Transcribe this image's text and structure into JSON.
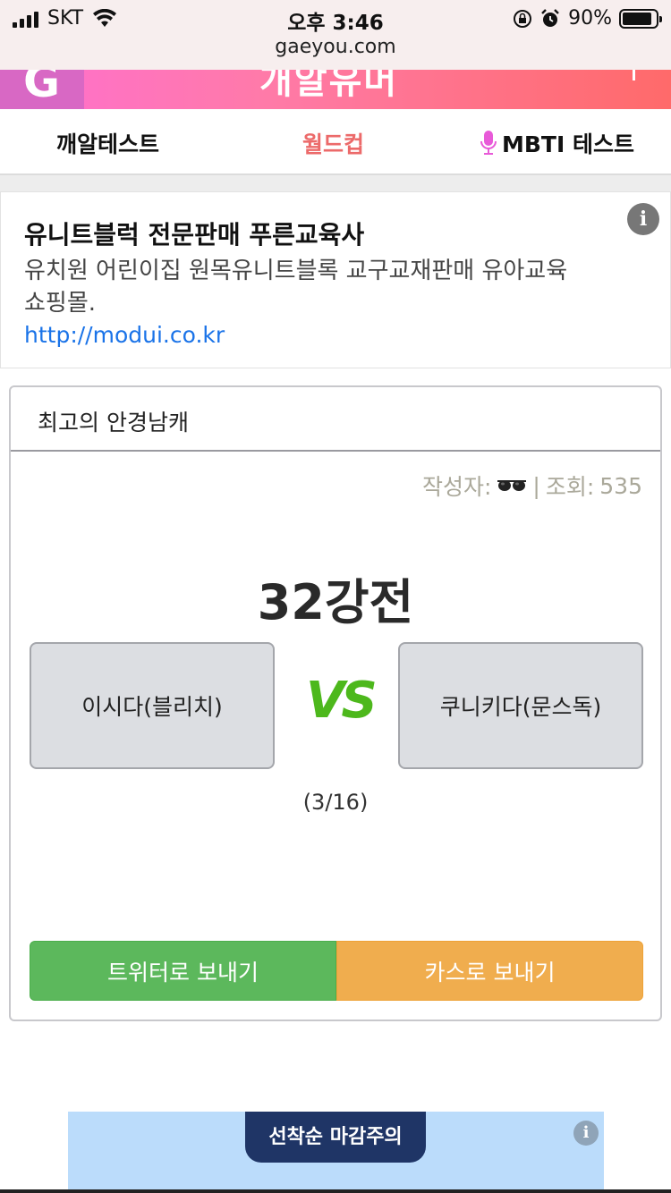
{
  "status_bar": {
    "carrier": "SKT",
    "time": "오후 3:46",
    "url": "gaeyou.com",
    "battery": "90%",
    "battery_level": 0.9
  },
  "banner": {
    "logo_letter": "G",
    "title": "개알유머"
  },
  "nav": {
    "items": [
      {
        "label": "깨알테스트"
      },
      {
        "label": "월드컵"
      },
      {
        "label": "MBTI 테스트"
      }
    ]
  },
  "ad": {
    "title": "유니트블럭 전문판매 푸른교육사",
    "description": "유치원 어린이집 원목유니트블록 교구교재판매 유아교육쇼핑몰.",
    "link": "http://modui.co.kr",
    "info_symbol": "i"
  },
  "worldcup": {
    "title": "최고의 안경남캐",
    "meta_author_label": "작성자:",
    "meta_separator": "|",
    "meta_views_label": "조회:",
    "meta_views": "535",
    "round": "32강전",
    "left_choice": "이시다(블리치)",
    "vs": "VS",
    "right_choice": "쿠니키다(문스독)",
    "progress": "(3/16)",
    "share_twitter": "트위터로 보내기",
    "share_kakao": "카스로 보내기"
  },
  "bottom_ad": {
    "badge": "선착순 마감주의",
    "info_symbol": "i"
  },
  "colors": {
    "nav_active": "#ec6a6a",
    "vs_green": "#4db81c",
    "twitter_green": "#5cb85c",
    "kakao_orange": "#f0ad4e",
    "ad_link": "#1a73e8"
  }
}
